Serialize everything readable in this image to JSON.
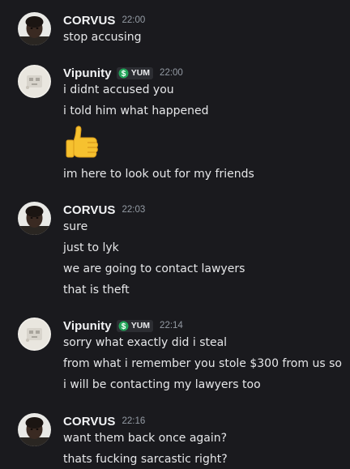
{
  "messages": [
    {
      "author": "CORVUS",
      "timestamp": "22:00",
      "lines": [
        "stop accusing"
      ]
    },
    {
      "author": "Vipunity",
      "tag": "YUM",
      "timestamp": "22:00",
      "lines": [
        "i didnt accused you",
        "i told him what happened"
      ],
      "emoji": "thumbs-up",
      "after_emoji": [
        "im here to look out for my friends"
      ]
    },
    {
      "author": "CORVUS",
      "timestamp": "22:03",
      "lines": [
        "sure",
        "just to lyk",
        "we are going to contact lawyers",
        "that is theft"
      ]
    },
    {
      "author": "Vipunity",
      "tag": "YUM",
      "timestamp": "22:14",
      "lines": [
        "sorry what exactly did i steal",
        "from what i remember you stole $300 from us so",
        "i will be contacting my lawyers too"
      ]
    },
    {
      "author": "CORVUS",
      "timestamp": "22:16",
      "lines": [
        "want them back once again?",
        "thats fucking sarcastic right?"
      ]
    }
  ],
  "colors": {
    "background": "#1a1a1e",
    "username": "#f2f3f5",
    "timestamp": "#949ba4",
    "message_text": "#e6e7e9",
    "tag_icon": "#23a55a"
  }
}
